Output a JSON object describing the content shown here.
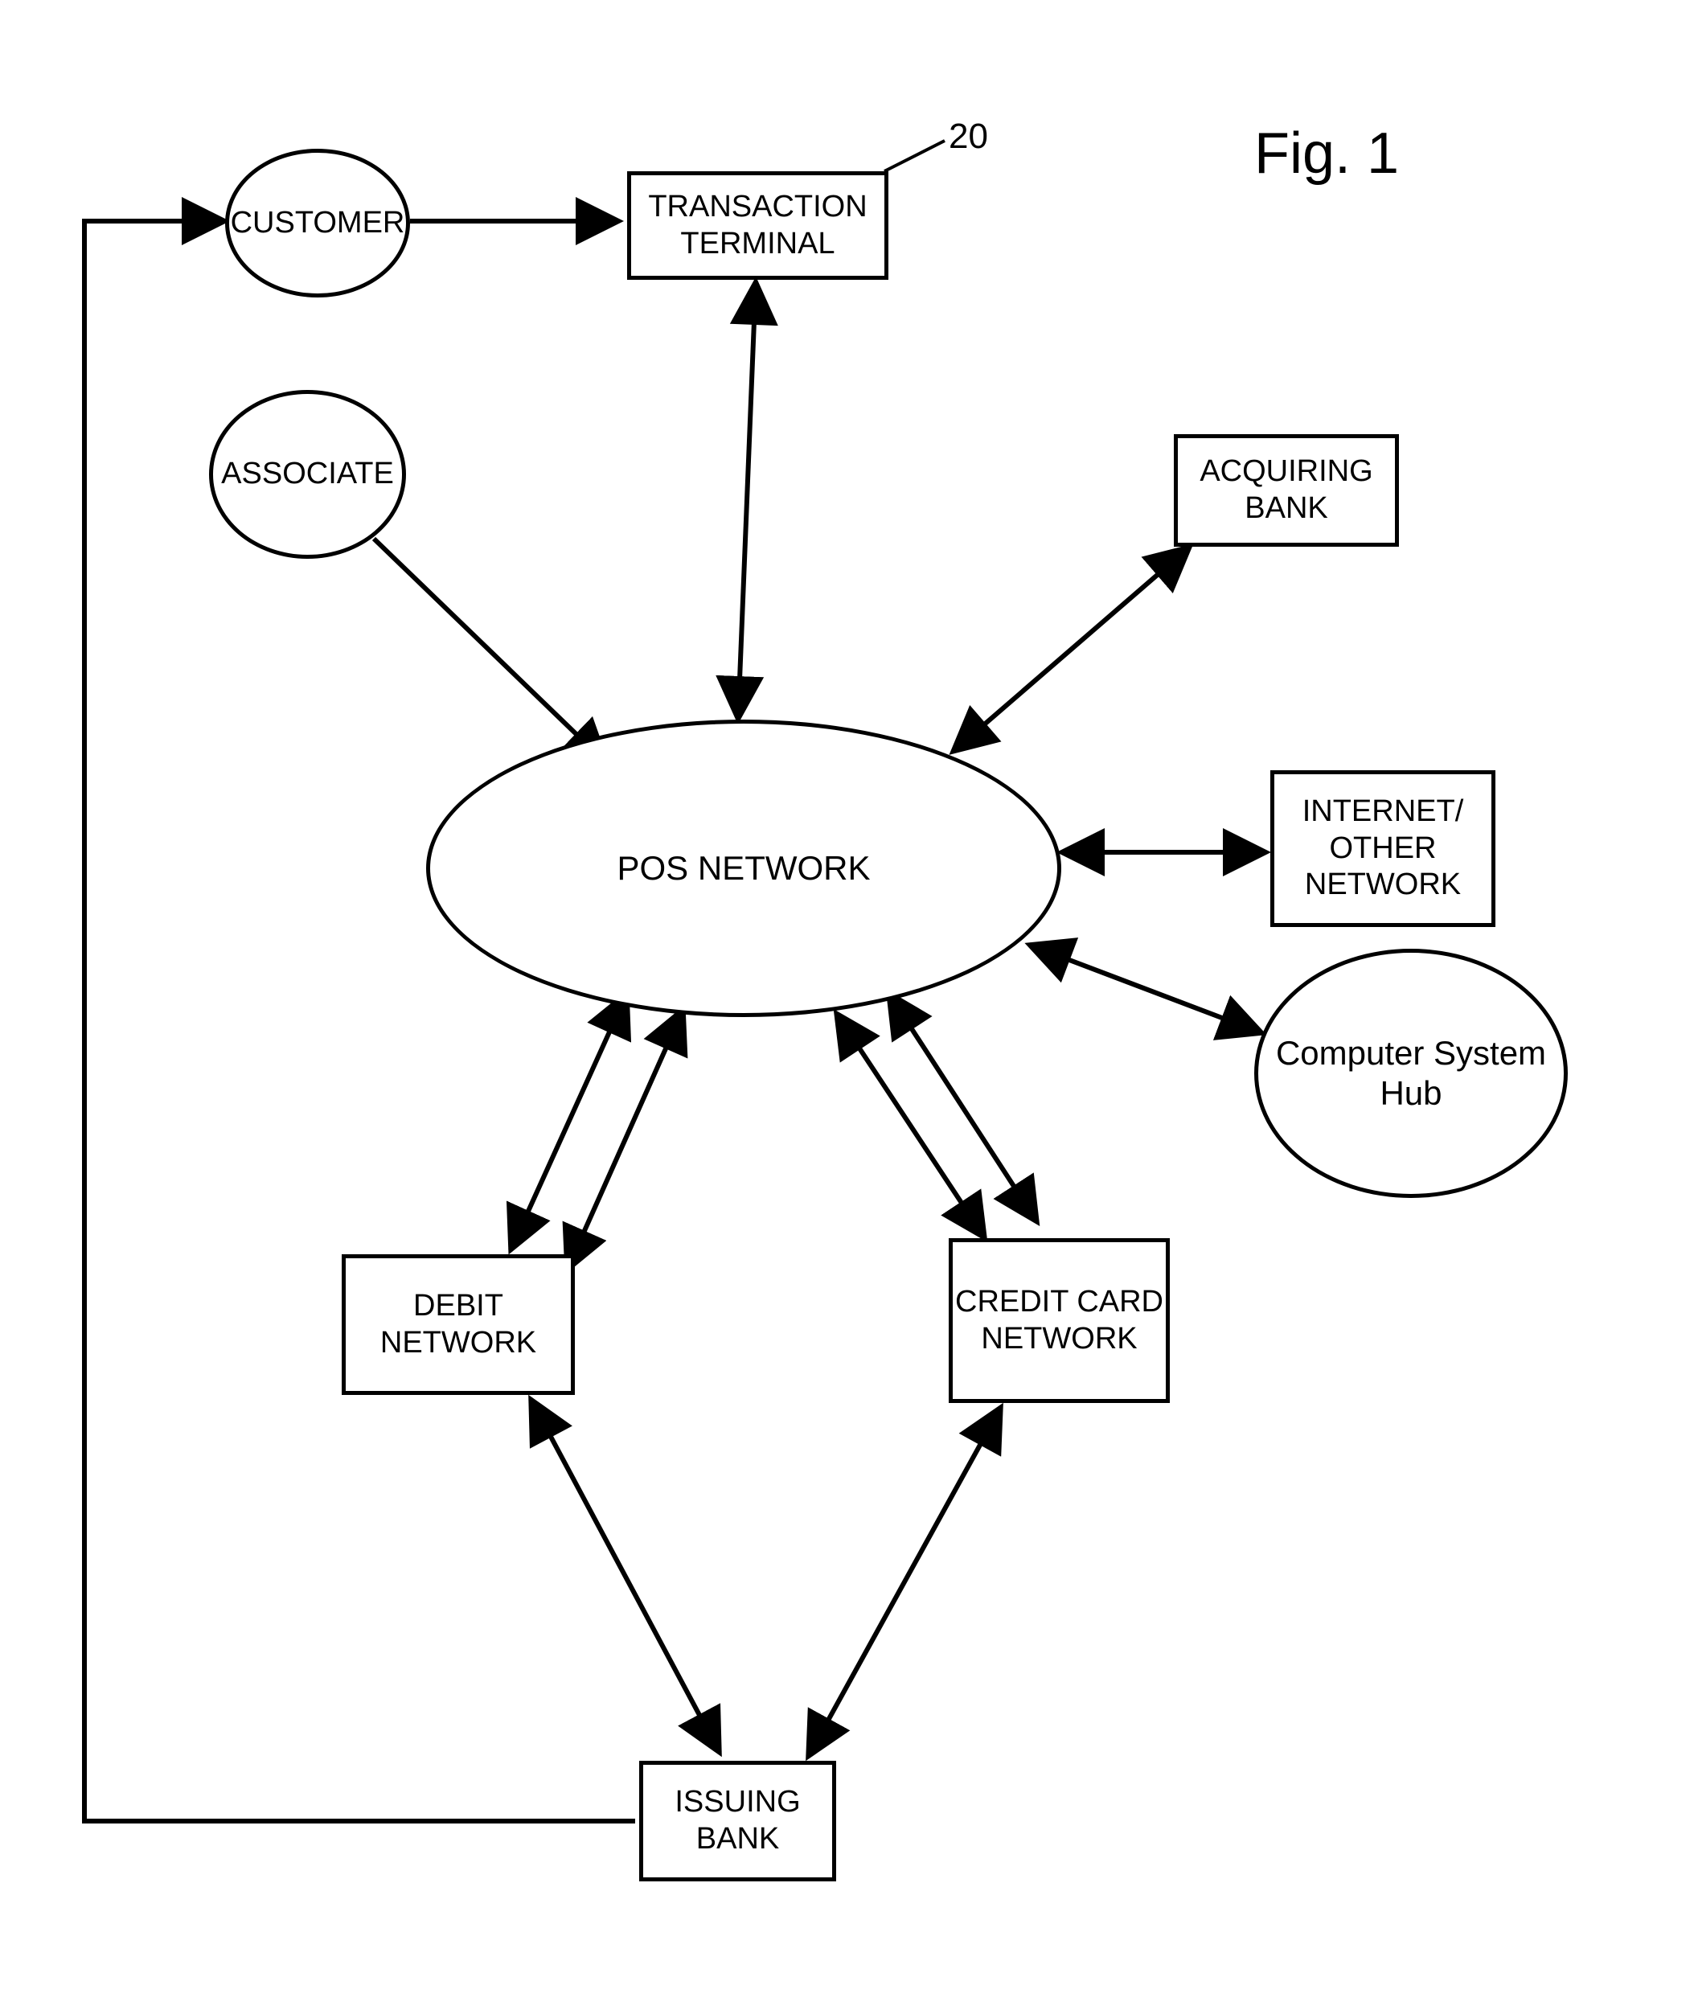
{
  "title": "Fig. 1",
  "ref_num": "20",
  "nodes": {
    "customer": "CUSTOMER",
    "associate": "ASSOCIATE",
    "transaction_terminal": "TRANSACTION TERMINAL",
    "acquiring_bank": "ACQUIRING BANK",
    "pos_network": "POS NETWORK",
    "internet_network": "INTERNET/ OTHER NETWORK",
    "computer_system_hub": "Computer System Hub",
    "debit_network": "DEBIT NETWORK",
    "credit_card_network": "CREDIT CARD NETWORK",
    "issuing_bank": "ISSUING BANK"
  },
  "connections": [
    {
      "from": "customer",
      "to": "transaction_terminal",
      "bidirectional": false
    },
    {
      "from": "transaction_terminal",
      "to": "pos_network",
      "bidirectional": true
    },
    {
      "from": "associate",
      "to": "pos_network",
      "bidirectional": false
    },
    {
      "from": "pos_network",
      "to": "acquiring_bank",
      "bidirectional": true
    },
    {
      "from": "pos_network",
      "to": "internet_network",
      "bidirectional": true
    },
    {
      "from": "pos_network",
      "to": "computer_system_hub",
      "bidirectional": true
    },
    {
      "from": "pos_network",
      "to": "debit_network",
      "bidirectional": true,
      "double_line": true
    },
    {
      "from": "pos_network",
      "to": "credit_card_network",
      "bidirectional": true,
      "double_line": true
    },
    {
      "from": "debit_network",
      "to": "issuing_bank",
      "bidirectional": true
    },
    {
      "from": "credit_card_network",
      "to": "issuing_bank",
      "bidirectional": true
    },
    {
      "from": "issuing_bank",
      "to": "customer",
      "bidirectional": false
    }
  ]
}
